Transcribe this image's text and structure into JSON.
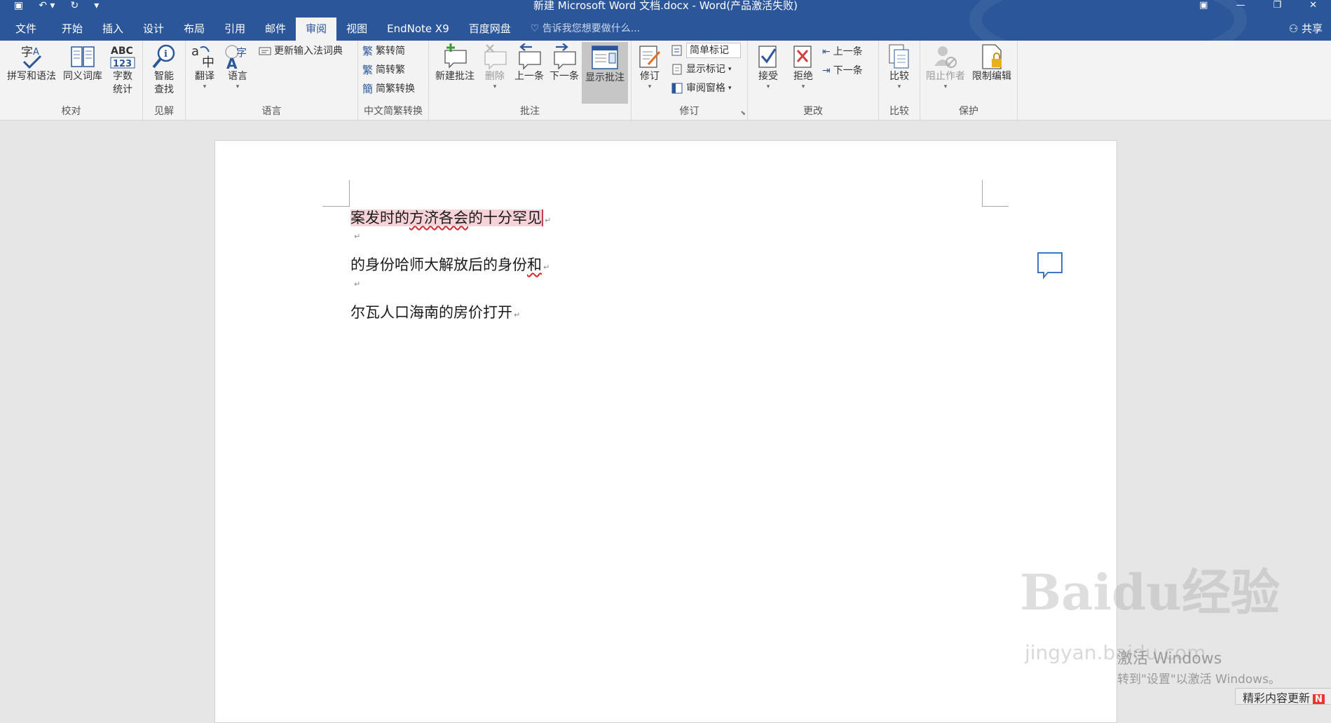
{
  "window": {
    "title": "新建 Microsoft Word 文档.docx - Word(产品激活失败)",
    "qat_icons": [
      "save-icon",
      "undo-icon",
      "redo-icon",
      "customize-icon"
    ]
  },
  "tabs": [
    "文件",
    "开始",
    "插入",
    "设计",
    "布局",
    "引用",
    "邮件",
    "审阅",
    "视图",
    "EndNote X9",
    "百度网盘"
  ],
  "active_tab": "审阅",
  "tell_me": "告诉我您想要做什么...",
  "share": "共享",
  "ribbon": {
    "proofing": {
      "label": "校对",
      "spelling": "拼写和语法",
      "thesaurus": "同义词库",
      "wordcount": "字数统计",
      "wordcount_l1": "字数",
      "wordcount_l2": "统计"
    },
    "insights": {
      "label": "见解",
      "smart_l1": "智能",
      "smart_l2": "查找"
    },
    "language": {
      "label": "语言",
      "translate": "翻译",
      "language": "语言",
      "update_ime": "更新输入法词典"
    },
    "chinese_conv": {
      "label": "中文简繁转换",
      "t2s": "繁转简",
      "s2t": "简转繁",
      "convert": "简繁转换"
    },
    "comments": {
      "label": "批注",
      "new": "新建批注",
      "delete": "删除",
      "prev": "上一条",
      "next": "下一条",
      "show": "显示批注"
    },
    "tracking": {
      "label": "修订",
      "track": "修订",
      "simple_markup": "简单标记",
      "show_markup": "显示标记",
      "review_pane": "审阅窗格"
    },
    "changes": {
      "label": "更改",
      "accept": "接受",
      "reject": "拒绝",
      "prev": "上一条",
      "next": "下一条"
    },
    "compare": {
      "label": "比较",
      "compare": "比较"
    },
    "protect": {
      "label": "保护",
      "block_authors": "阻止作者",
      "restrict": "限制编辑"
    }
  },
  "document": {
    "paragraphs": [
      "案发时的方济各会的十分罕见",
      "",
      "的身份哈师大解放后的身份和",
      "",
      "尔瓦人口海南的房价打开"
    ],
    "para_mark": "↵"
  },
  "watermark": {
    "brand": "Baidu经验",
    "url": "jingyan.baidu.com"
  },
  "activation": {
    "line1": "激活 Windows",
    "line2": "转到\"设置\"以激活 Windows。"
  },
  "update_notice": {
    "text": "精彩内容更新",
    "badge": "N"
  },
  "colors": {
    "titlebar": "#2b579a",
    "ribbon": "#f3f3f3",
    "comment_highlight": "#f6d3d9"
  }
}
